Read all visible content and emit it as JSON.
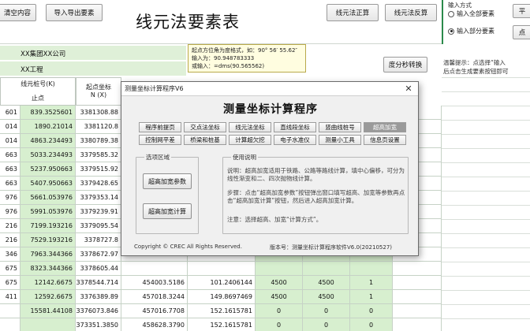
{
  "toolbar": {
    "clear_label": "清空内容",
    "import_export_label": "导入导出要素",
    "sheet_title": "线元法要素表",
    "forward_label": "线元法正算",
    "inverse_label": "线元法反算"
  },
  "options": {
    "title": "输入方式",
    "option_all": "输入全部要素",
    "option_partial": "输入部分要素",
    "edge_btn1": "平",
    "edge_btn2": "点"
  },
  "header": {
    "company": "XX集团XX公司",
    "project": "XX工程",
    "convert_label": "度分秒转换",
    "hint_line1": "温馨提示：点选择“输入",
    "hint_line2": "后点击生成要素按钮即可"
  },
  "tooltip": {
    "line1": "起点方位角为度格式，如：90° 56′ 55.62″",
    "line2": "输入为：90.948783333",
    "line3": "或输入：=dms(90.565562)"
  },
  "columns": {
    "line_no": "线元桩号(K)",
    "end": "止点",
    "start_coord": "起点坐标",
    "start_coord_n": "N (X)"
  },
  "grid": {
    "col_a": [
      "601",
      "014",
      "014",
      "663",
      "663",
      "663",
      "976",
      "976",
      "216",
      "216",
      "346",
      "675",
      "675",
      "411"
    ],
    "col_b": [
      "839.3525601",
      "1890.21014",
      "4863.234493",
      "5033.234493",
      "5237.950663",
      "5407.950663",
      "5661.053976",
      "5991.053976",
      "7199.193216",
      "7529.193216",
      "7963.344366",
      "8323.344366",
      "12142.6675",
      "12592.6675",
      "15581.44108",
      ""
    ],
    "col_c": [
      "3381308.88",
      "3381120.8",
      "3380789.38",
      "3379585.32",
      "3379515.92",
      "3379428.65",
      "3379353.14",
      "3379239.91",
      "3379095.54",
      "3378727.8",
      "3378672.97",
      "3378605.44",
      "3378544.714",
      "3376389.89",
      "3376073.846",
      "3373351.3850"
    ],
    "col_d": [
      "",
      "",
      "",
      "",
      "",
      "",
      "",
      "",
      "",
      "",
      "",
      "",
      "454003.5186",
      "457018.3244",
      "457016.7708",
      "458628.3790"
    ],
    "col_e": [
      "",
      "",
      "",
      "",
      "",
      "",
      "",
      "",
      "",
      "",
      "",
      "",
      "101.2406144",
      "149.8697469",
      "152.1615781",
      "152.1615781"
    ],
    "col_f": [
      "",
      "",
      "",
      "",
      "",
      "",
      "",
      "",
      "",
      "",
      "",
      "",
      "4500",
      "4500",
      "0",
      "0"
    ],
    "col_g": [
      "",
      "",
      "",
      "",
      "",
      "",
      "",
      "",
      "",
      "",
      "",
      "",
      "4500",
      "4500",
      "0",
      "0"
    ],
    "col_h": [
      "",
      "",
      "",
      "",
      "",
      "",
      "",
      "",
      "",
      "",
      "",
      "",
      "1",
      "1",
      "0",
      "0"
    ]
  },
  "dialog": {
    "window_title": "测量坐标计算程序V6",
    "close_glyph": "✕",
    "heading": "测量坐标计算程序",
    "tabs_row1": [
      "程序前提页",
      "交点法坐标",
      "线元法坐标",
      "直线段坐标",
      "竖曲线桩号",
      "超高加宽"
    ],
    "tabs_row2": [
      "控制网平差",
      "桥梁和桩基",
      "计算超欠挖",
      "电子水准仪",
      "测量小工具",
      "信息页设置"
    ],
    "group_select": "选项区域",
    "btn_params": "超高加宽参数",
    "btn_compute": "超高加宽计算",
    "group_usage": "使用说明",
    "usage1": "说明：超高加宽适用于铁路、公路等路线计算，填中心偏移，可分为线性渐变和二、四次抛物线计算。",
    "usage2": "步骤：点击“超高加宽参数”按钮弹出窗口填写超高、加宽等参数再点击“超高加宽计算”按钮，然后进入超高加宽计算。",
    "usage3": "注意：选择超高、加宽“计算方式”。",
    "footer_copyright": "Copyright © CREC All Rights Reserved.",
    "footer_version": "版本号：测量坐标计算程序软件V6.0(20210527)"
  }
}
